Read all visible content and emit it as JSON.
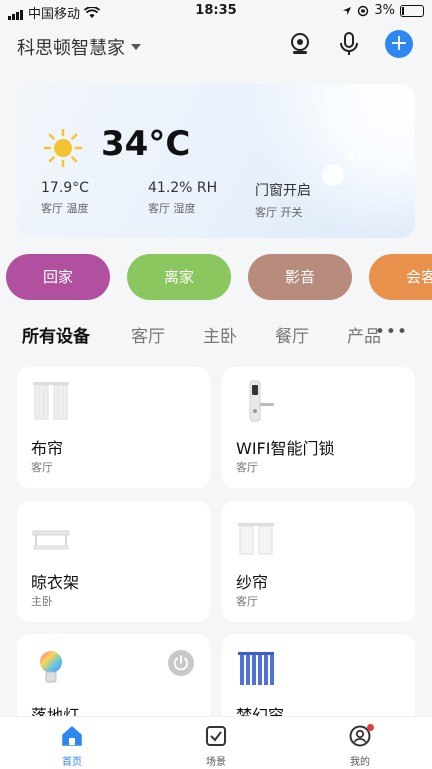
{
  "status_bar": {
    "carrier": "中国移动",
    "time": "18:35",
    "battery": "3%"
  },
  "header": {
    "home_name": "科思顿智慧家"
  },
  "weather": {
    "temperature": "34°C",
    "stats": [
      {
        "value": "17.9°C",
        "label": "客厅 温度"
      },
      {
        "value": "41.2% RH",
        "label": "客厅 湿度"
      },
      {
        "value": "门窗开启",
        "label": "客厅 开关"
      }
    ]
  },
  "scenes": [
    {
      "label": "回家",
      "color": "#b1509f"
    },
    {
      "label": "离家",
      "color": "#8ac75f"
    },
    {
      "label": "影音",
      "color": "#b88c7c"
    },
    {
      "label": "会客",
      "color": "#e8914c"
    }
  ],
  "tabs": [
    "所有设备",
    "客厅",
    "主卧",
    "餐厅",
    "产品"
  ],
  "devices": [
    {
      "name": "布帘",
      "room": "客厅",
      "icon": "curtain-icon"
    },
    {
      "name": "WIFI智能门锁",
      "room": "客厅",
      "icon": "door-lock-icon"
    },
    {
      "name": "晾衣架",
      "room": "主卧",
      "icon": "clothes-rack-icon"
    },
    {
      "name": "纱帘",
      "room": "客厅",
      "icon": "sheer-curtain-icon"
    },
    {
      "name": "落地灯",
      "room": "",
      "icon": "bulb-icon"
    },
    {
      "name": "梦幻帘",
      "room": "",
      "icon": "blinds-icon"
    }
  ],
  "tabbar": [
    {
      "label": "首页",
      "active": true
    },
    {
      "label": "场景",
      "active": false
    },
    {
      "label": "我的",
      "active": false
    }
  ],
  "colors": {
    "accent": "#2e86f0"
  }
}
